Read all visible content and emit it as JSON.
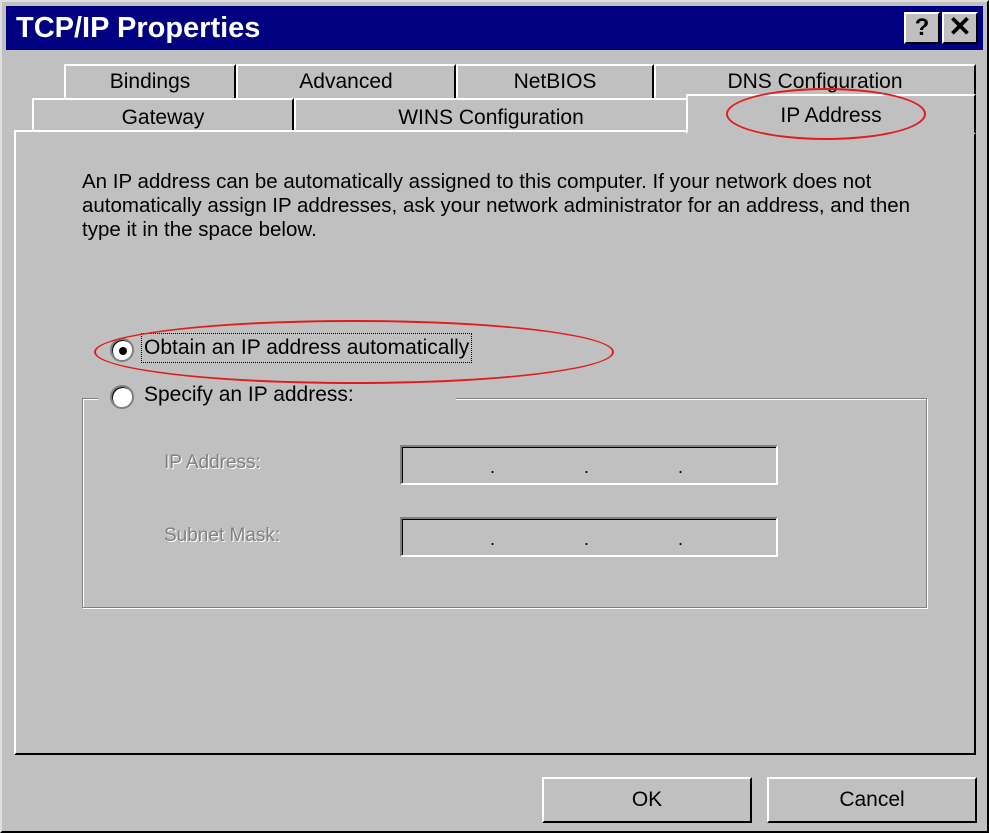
{
  "window": {
    "title": "TCP/IP Properties",
    "help_label": "?",
    "close_label": "✕"
  },
  "tabs": {
    "row1": [
      "Bindings",
      "Advanced",
      "NetBIOS",
      "DNS Configuration"
    ],
    "row2": [
      "Gateway",
      "WINS Configuration",
      "IP Address"
    ],
    "active": "IP Address"
  },
  "description": "An IP address can be automatically assigned to this computer. If your network does not automatically assign IP addresses, ask your network administrator for an address, and then type it in the space below.",
  "options": {
    "obtain_auto": {
      "label": "Obtain an IP address automatically",
      "selected": true
    },
    "specify": {
      "label": "Specify an IP address:",
      "selected": false
    }
  },
  "fields": {
    "ip_address_label": "IP Address:",
    "subnet_mask_label": "Subnet Mask:",
    "ip_address_value": [
      "",
      "",
      "",
      ""
    ],
    "subnet_mask_value": [
      "",
      "",
      "",
      ""
    ],
    "separator": "."
  },
  "buttons": {
    "ok": "OK",
    "cancel": "Cancel"
  },
  "colors": {
    "titlebar": "#000080",
    "face": "#c0c0c0",
    "annotation": "#e21b1b"
  }
}
